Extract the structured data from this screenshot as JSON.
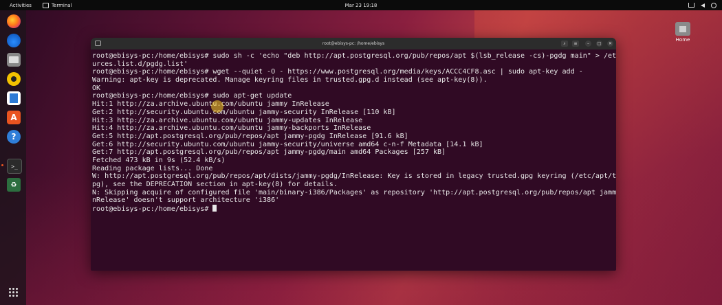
{
  "topbar": {
    "activities": "Activities",
    "app_name": "Terminal",
    "clock": "Mar 23  19:18",
    "tray_icons": [
      "network-icon",
      "volume-icon",
      "power-icon"
    ]
  },
  "dock": {
    "items": [
      "firefox",
      "thunderbird",
      "files",
      "rhythmbox",
      "libreoffice-writer",
      "app-center",
      "help",
      "terminal",
      "trash",
      "show-apps"
    ],
    "store_glyph": "A",
    "help_glyph": "?",
    "term_glyph": ">_",
    "trash_glyph": "♻"
  },
  "desktop": {
    "home_label": "Home"
  },
  "terminal": {
    "title": "root@ebisys-pc: /home/ebisys",
    "lines": [
      "root@ebisys-pc:/home/ebisys# sudo sh -c 'echo \"deb http://apt.postgresql.org/pub/repos/apt $(lsb_release -cs)-pgdg main\" > /etc/apt/so",
      "urces.list.d/pgdg.list'",
      "root@ebisys-pc:/home/ebisys# wget --quiet -O - https://www.postgresql.org/media/keys/ACCC4CF8.asc | sudo apt-key add -",
      "Warning: apt-key is deprecated. Manage keyring files in trusted.gpg.d instead (see apt-key(8)).",
      "OK",
      "root@ebisys-pc:/home/ebisys# sudo apt-get update",
      "Hit:1 http://za.archive.ubuntu.com/ubuntu jammy InRelease",
      "Get:2 http://security.ubuntu.com/ubuntu jammy-security InRelease [110 kB]",
      "Hit:3 http://za.archive.ubuntu.com/ubuntu jammy-updates InRelease",
      "Hit:4 http://za.archive.ubuntu.com/ubuntu jammy-backports InRelease",
      "Get:5 http://apt.postgresql.org/pub/repos/apt jammy-pgdg InRelease [91.6 kB]",
      "Get:6 http://security.ubuntu.com/ubuntu jammy-security/universe amd64 c-n-f Metadata [14.1 kB]",
      "Get:7 http://apt.postgresql.org/pub/repos/apt jammy-pgdg/main amd64 Packages [257 kB]",
      "Fetched 473 kB in 9s (52.4 kB/s)",
      "Reading package lists... Done",
      "W: http://apt.postgresql.org/pub/repos/apt/dists/jammy-pgdg/InRelease: Key is stored in legacy trusted.gpg keyring (/etc/apt/trusted.g",
      "pg), see the DEPRECATION section in apt-key(8) for details.",
      "N: Skipping acquire of configured file 'main/binary-i386/Packages' as repository 'http://apt.postgresql.org/pub/repos/apt jammy-pgdg I",
      "nRelease' doesn't support architecture 'i386'"
    ],
    "prompt": "root@ebisys-pc:/home/ebisys# "
  }
}
